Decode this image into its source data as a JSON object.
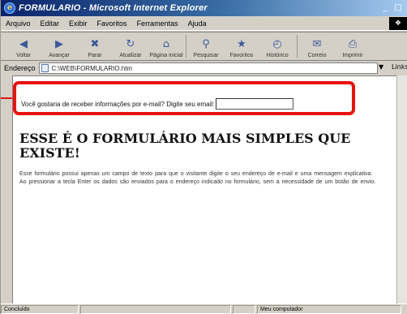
{
  "window": {
    "title": "FORMULARIO - Microsoft Internet Explorer",
    "controls": {
      "minimize": "_",
      "maximize": "□",
      "close": "×"
    }
  },
  "menu": {
    "items": [
      "Arquivo",
      "Editar",
      "Exibir",
      "Favoritos",
      "Ferramentas",
      "Ajuda"
    ]
  },
  "toolbar": {
    "back": "Voltar",
    "forward": "Avançar",
    "stop": "Parar",
    "refresh": "Atualizar",
    "home": "Página inicial",
    "search": "Pesquisar",
    "favorites": "Favoritos",
    "history": "Histórico",
    "mail": "Correio",
    "print": "Imprimir"
  },
  "address": {
    "label": "Endereço",
    "value": "C:\\WEB\\FORMULARIO.htm",
    "links": "Links"
  },
  "form": {
    "label": "Você gostaria de receber informações por e-mail? Digite seu email:",
    "input_value": ""
  },
  "page": {
    "heading": "ESSE É O FORMULÁRIO MAIS SIMPLES QUE EXISTE!",
    "paragraph": "Esse formulário possui apenas um campo de texto para que o visitante digite o seu endereço de e-mail e uma mensagem explicativa. Ao pressionar a tecla Enter os dados são enviados para o endereço indicado no formulário, sem a necessidade de um botão de envio."
  },
  "status": {
    "left": "Concluído",
    "zone": "Meu computador"
  },
  "colors": {
    "highlight": "#e8130f",
    "title_start": "#0a246a",
    "title_end": "#a6caf0"
  }
}
